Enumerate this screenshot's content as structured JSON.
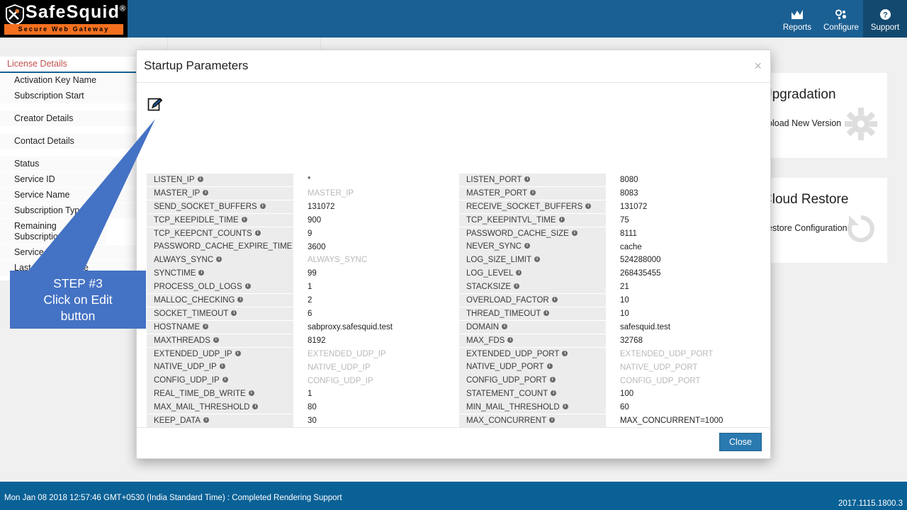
{
  "brand": {
    "name": "SafeSquid",
    "registered": "®",
    "tagline": "Secure Web Gateway",
    "accent_orange": "#f4701f",
    "header_blue": "#1b6093",
    "status_blue": "#0a6196"
  },
  "nav": {
    "items": [
      {
        "label": "Reports",
        "icon": "chart-icon",
        "active": false
      },
      {
        "label": "Configure",
        "icon": "gear-settings-icon",
        "active": false
      },
      {
        "label": "Support",
        "icon": "help-circle-icon",
        "active": true
      }
    ]
  },
  "left_panel": {
    "title": "License Details",
    "rows": [
      "Activation Key Name",
      "Subscription Start",
      "Creator Details",
      "Contact Details",
      "Status",
      "Service ID",
      "Service Name",
      "Subscription Type",
      "Remaining Subscription Quantity",
      "Service Location",
      "Last Updated Time"
    ]
  },
  "right_cards": [
    {
      "title": "Upgradation",
      "subtitle": "Upload New Version",
      "icon": "gear-icon"
    },
    {
      "title": "Cloud Restore",
      "subtitle": "Restore Configuration",
      "icon": "restore-arrow-icon"
    }
  ],
  "modal": {
    "title": "Startup Parameters",
    "close_x": "×",
    "edit_icon": "edit-pencil-icon",
    "footer_button": "Close",
    "info_glyph": "i",
    "left_params": [
      {
        "name": "LISTEN_IP",
        "value": "*",
        "placeholder": false
      },
      {
        "name": "MASTER_IP",
        "value": "MASTER_IP",
        "placeholder": true
      },
      {
        "name": "SEND_SOCKET_BUFFERS",
        "value": "131072",
        "placeholder": false
      },
      {
        "name": "TCP_KEEPIDLE_TIME",
        "value": "900",
        "placeholder": false
      },
      {
        "name": "TCP_KEEPCNT_COUNTS",
        "value": "9",
        "placeholder": false
      },
      {
        "name": "PASSWORD_CACHE_EXPIRE_TIME",
        "value": "3600",
        "placeholder": false
      },
      {
        "name": "ALWAYS_SYNC",
        "value": "ALWAYS_SYNC",
        "placeholder": true
      },
      {
        "name": "SYNCTIME",
        "value": "99",
        "placeholder": false
      },
      {
        "name": "PROCESS_OLD_LOGS",
        "value": "1",
        "placeholder": false
      },
      {
        "name": "MALLOC_CHECKING",
        "value": "2",
        "placeholder": false
      },
      {
        "name": "SOCKET_TIMEOUT",
        "value": "6",
        "placeholder": false
      },
      {
        "name": "HOSTNAME",
        "value": "sabproxy.safesquid.test",
        "placeholder": false
      },
      {
        "name": "MAXTHREADS",
        "value": "8192",
        "placeholder": false
      },
      {
        "name": "EXTENDED_UDP_IP",
        "value": "EXTENDED_UDP_IP",
        "placeholder": true
      },
      {
        "name": "NATIVE_UDP_IP",
        "value": "NATIVE_UDP_IP",
        "placeholder": true
      },
      {
        "name": "CONFIG_UDP_IP",
        "value": "CONFIG_UDP_IP",
        "placeholder": true
      },
      {
        "name": "REAL_TIME_DB_WRITE",
        "value": "1",
        "placeholder": false
      },
      {
        "name": "MAX_MAIL_THRESHOLD",
        "value": "80",
        "placeholder": false
      },
      {
        "name": "KEEP_DATA",
        "value": "30",
        "placeholder": false
      }
    ],
    "right_params": [
      {
        "name": "LISTEN_PORT",
        "value": "8080",
        "placeholder": false
      },
      {
        "name": "MASTER_PORT",
        "value": "8083",
        "placeholder": false
      },
      {
        "name": "RECEIVE_SOCKET_BUFFERS",
        "value": "131072",
        "placeholder": false
      },
      {
        "name": "TCP_KEEPINTVL_TIME",
        "value": "75",
        "placeholder": false
      },
      {
        "name": "PASSWORD_CACHE_SIZE",
        "value": "8111",
        "placeholder": false
      },
      {
        "name": "NEVER_SYNC",
        "value": "cache",
        "placeholder": false
      },
      {
        "name": "LOG_SIZE_LIMIT",
        "value": "524288000",
        "placeholder": false
      },
      {
        "name": "LOG_LEVEL",
        "value": "268435455",
        "placeholder": false
      },
      {
        "name": "STACKSIZE",
        "value": "21",
        "placeholder": false
      },
      {
        "name": "OVERLOAD_FACTOR",
        "value": "10",
        "placeholder": false
      },
      {
        "name": "THREAD_TIMEOUT",
        "value": "10",
        "placeholder": false
      },
      {
        "name": "DOMAIN",
        "value": "safesquid.test",
        "placeholder": false
      },
      {
        "name": "MAX_FDS",
        "value": "32768",
        "placeholder": false
      },
      {
        "name": "EXTENDED_UDP_PORT",
        "value": "EXTENDED_UDP_PORT",
        "placeholder": true
      },
      {
        "name": "NATIVE_UDP_PORT",
        "value": "NATIVE_UDP_PORT",
        "placeholder": true
      },
      {
        "name": "CONFIG_UDP_PORT",
        "value": "CONFIG_UDP_PORT",
        "placeholder": true
      },
      {
        "name": "STATEMENT_COUNT",
        "value": "100",
        "placeholder": false
      },
      {
        "name": "MIN_MAIL_THRESHOLD",
        "value": "60",
        "placeholder": false
      },
      {
        "name": "MAX_CONCURRENT",
        "value": "MAX_CONCURRENT=1000",
        "placeholder": false
      }
    ]
  },
  "callout": {
    "line1": "STEP #3",
    "line2": "Click on Edit",
    "line3": "button",
    "color": "#4472c4"
  },
  "statusbar": {
    "left": "Mon Jan 08 2018 12:57:46 GMT+0530 (India Standard Time) : Completed Rendering Support",
    "right": "2017.1115.1800.3"
  }
}
